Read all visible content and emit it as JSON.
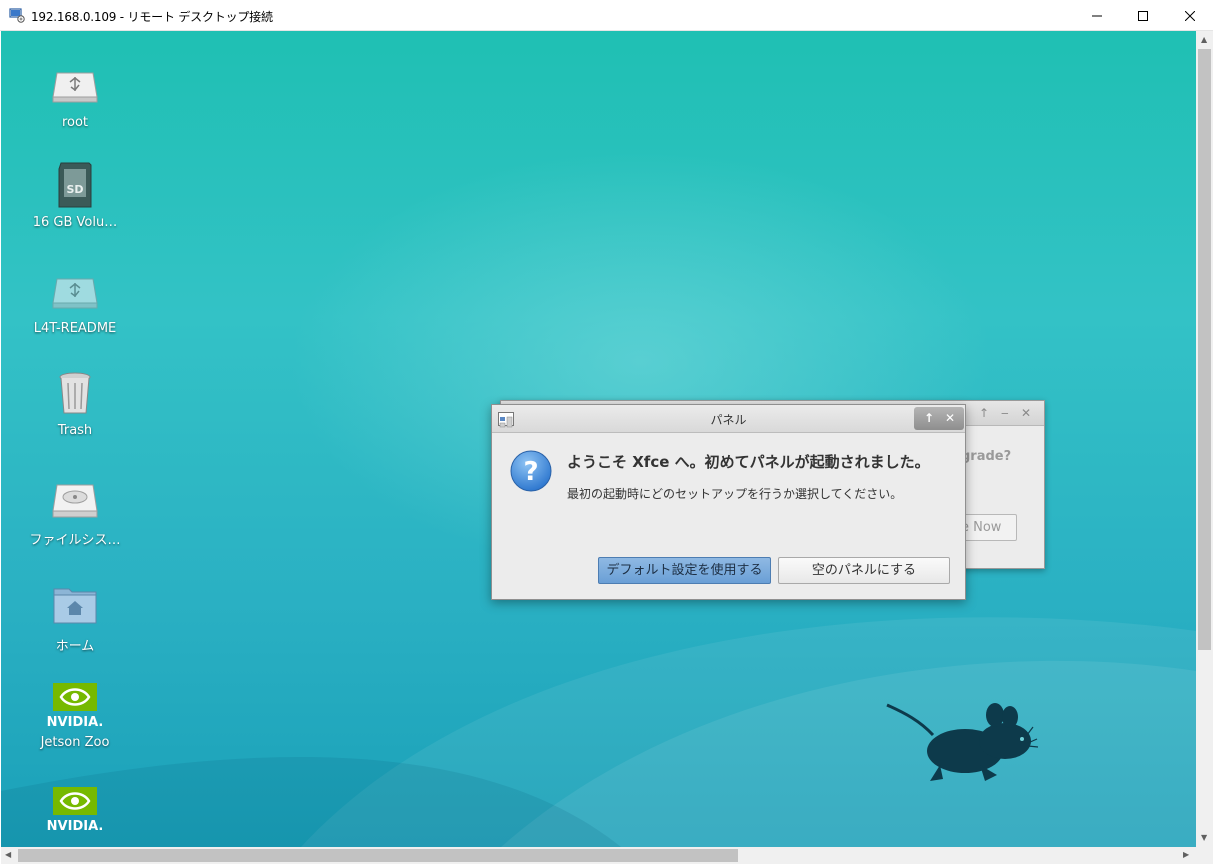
{
  "window": {
    "title": "192.168.0.109 - リモート デスクトップ接続",
    "controls": {
      "minimize": "─",
      "maximize": "☐",
      "close": "✕"
    }
  },
  "desktop": {
    "icons": [
      {
        "label": "root",
        "icon": "usb-drive-icon"
      },
      {
        "label": "16 GB Volu…",
        "icon": "sd-card-icon"
      },
      {
        "label": "L4T-README",
        "icon": "usb-drive-icon"
      },
      {
        "label": "Trash",
        "icon": "trash-icon"
      },
      {
        "label": "ファイルシス…",
        "icon": "hard-drive-icon"
      },
      {
        "label": "ホーム",
        "icon": "home-folder-icon"
      },
      {
        "label": "Jetson Zoo",
        "icon": "nvidia-icon",
        "brand": "NVIDIA."
      },
      {
        "label": "",
        "icon": "nvidia-icon",
        "brand": "NVIDIA."
      }
    ]
  },
  "background_dialog": {
    "text": "grade?",
    "button": "e Now"
  },
  "dialog": {
    "title": "パネル",
    "heading": "ようこそ Xfce へ。初めてパネルが起動されました。",
    "message": "最初の起動時にどのセットアップを行うか選択してください。",
    "default_button": "デフォルト設定を使用する",
    "empty_button": "空のパネルにする"
  },
  "colors": {
    "desktop": "#2ec1c0",
    "nvidia_green": "#76b900",
    "default_button": "#7aaade"
  }
}
